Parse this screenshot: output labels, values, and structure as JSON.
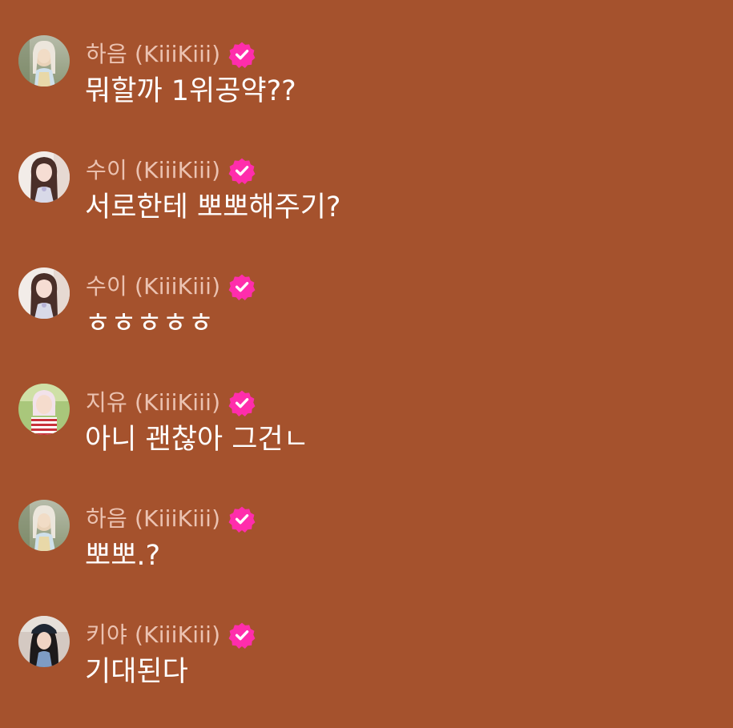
{
  "colors": {
    "background": "#a5522d",
    "verified_badge": "#ff2dac"
  },
  "messages": [
    {
      "name": "하음 (KiiiKiii)",
      "text": "뭐할까 1위공약??",
      "avatar": "haeum-avatar",
      "verified": true
    },
    {
      "name": "수이 (KiiiKiii)",
      "text": "서로한테 뽀뽀해주기?",
      "avatar": "sui-avatar",
      "verified": true
    },
    {
      "name": "수이 (KiiiKiii)",
      "text": "ㅎㅎㅎㅎㅎ",
      "avatar": "sui-avatar",
      "verified": true
    },
    {
      "name": "지유 (KiiiKiii)",
      "text": "아니 괜찮아 그건ㄴ",
      "avatar": "jiyu-avatar",
      "verified": true
    },
    {
      "name": "하음 (KiiiKiii)",
      "text": "뽀뽀.?",
      "avatar": "haeum-avatar",
      "verified": true
    },
    {
      "name": "키야 (KiiiKiii)",
      "text": "기대된다",
      "avatar": "kiya-avatar",
      "verified": true
    }
  ]
}
